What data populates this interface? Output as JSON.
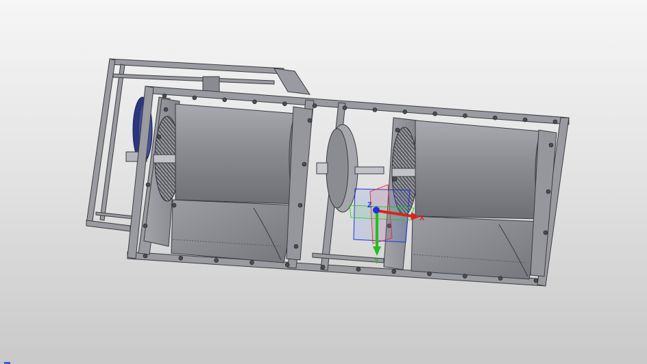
{
  "viewport": {
    "background_top": "#f6f6f6",
    "background_bottom": "#c9c9c9"
  },
  "model": {
    "part_color": "#8f9096",
    "frame_color": "#9a9ba0",
    "edge_color": "#3a3b3f",
    "motor_accent": "#3040a0"
  },
  "triad": {
    "x_label": "X",
    "y_label": "Y",
    "z_label": "Z",
    "x_color": "#e02020",
    "y_color": "#20c020",
    "z_color": "#2030e0"
  }
}
